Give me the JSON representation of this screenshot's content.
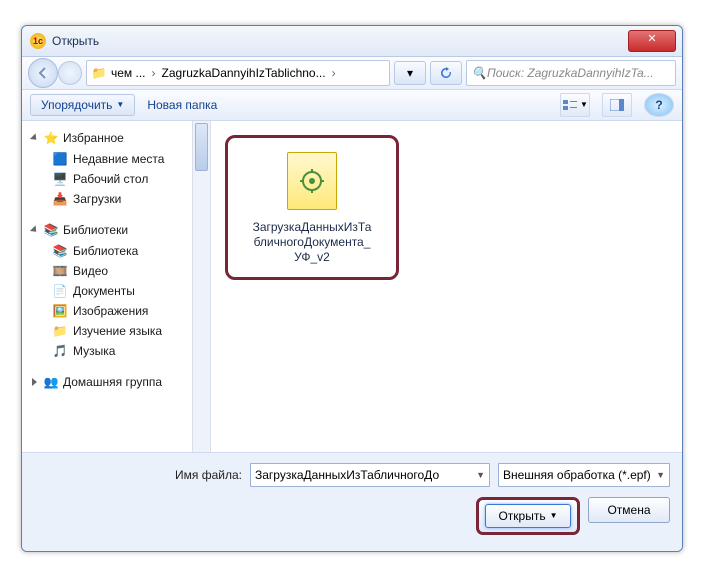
{
  "window": {
    "title": "Открыть"
  },
  "nav": {
    "crumb_pre": "чем ...",
    "crumb_main": "ZagruzkaDannyihIzTablichno...",
    "search_placeholder": "Поиск: ZagruzkaDannyihIzTa..."
  },
  "toolbar": {
    "organize": "Упорядочить",
    "newfolder": "Новая папка"
  },
  "tree": {
    "fav": "Избранное",
    "fav_items": [
      "Недавние места",
      "Рабочий стол",
      "Загрузки"
    ],
    "lib": "Библиотеки",
    "lib_items": [
      "Библиотека",
      "Видео",
      "Документы",
      "Изображения",
      "Изучение языка",
      "Музыка"
    ],
    "home": "Домашняя группа"
  },
  "file": {
    "label": "ЗагрузкаДанныхИзТабличногоДокумента_УФ_v2"
  },
  "footer": {
    "filename_label": "Имя файла:",
    "filename_value": "ЗагрузкаДанныхИзТабличногоДо",
    "filter_value": "Внешняя обработка (*.epf)",
    "open": "Открыть",
    "cancel": "Отмена"
  }
}
